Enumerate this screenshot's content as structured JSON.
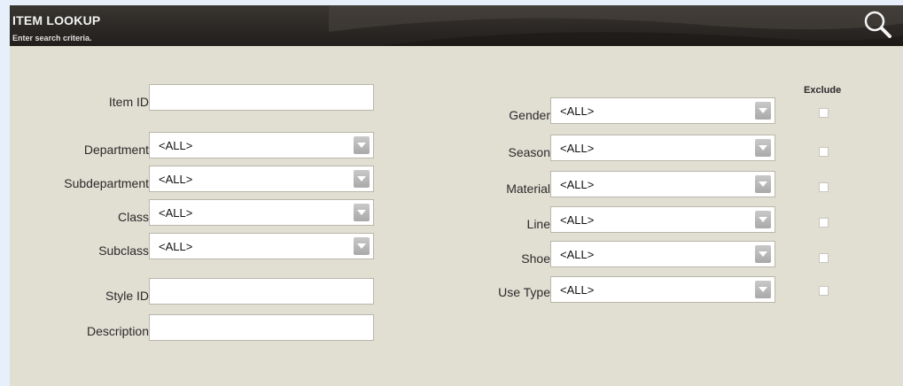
{
  "header": {
    "title": "ITEM LOOKUP",
    "subtitle": "Enter search criteria.",
    "search_icon": "magnifier-icon"
  },
  "left_fields": {
    "item_id": {
      "label": "Item ID",
      "value": ""
    },
    "department": {
      "label": "Department",
      "value": "<ALL>"
    },
    "subdepartment": {
      "label": "Subdepartment",
      "value": "<ALL>"
    },
    "class": {
      "label": "Class",
      "value": "<ALL>"
    },
    "subclass": {
      "label": "Subclass",
      "value": "<ALL>"
    },
    "style_id": {
      "label": "Style ID",
      "value": ""
    },
    "description": {
      "label": "Description",
      "value": ""
    }
  },
  "exclude_header": "Exclude",
  "right_fields": {
    "gender": {
      "label": "Gender",
      "value": "<ALL>",
      "exclude": false
    },
    "season": {
      "label": "Season",
      "value": "<ALL>",
      "exclude": false
    },
    "material": {
      "label": "Material",
      "value": "<ALL>",
      "exclude": false
    },
    "line": {
      "label": "Line",
      "value": "<ALL>",
      "exclude": false
    },
    "shoe": {
      "label": "Shoe",
      "value": "<ALL>",
      "exclude": false
    },
    "use_type": {
      "label": "Use Type",
      "value": "<ALL>",
      "exclude": false
    }
  },
  "colors": {
    "page_bg": "#e7f0fa",
    "panel_bg": "#e1ded2",
    "header_bg": "#2b2825"
  }
}
